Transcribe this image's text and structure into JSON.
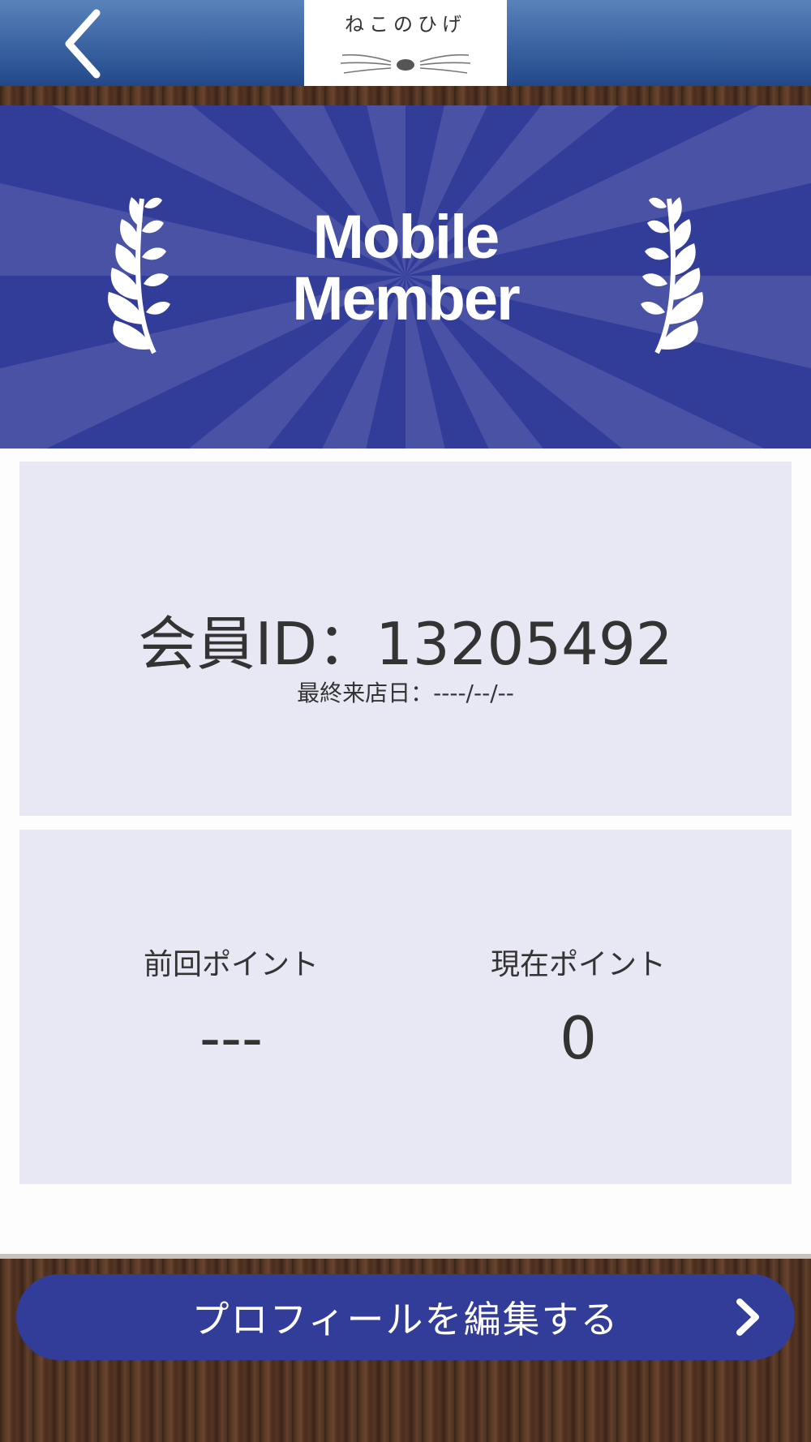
{
  "header": {
    "back_icon": "chevron-left-icon",
    "logo_text": "ねこのひげ"
  },
  "banner": {
    "title_line1": "Mobile",
    "title_line2": "Member",
    "colors": {
      "background": "#323c99",
      "ray": "#4a52a6"
    }
  },
  "member": {
    "id_label": "会員ID：",
    "id_value": "13205492",
    "last_visit": "最終来店日：----/--/--"
  },
  "points": {
    "previous_label": "前回ポイント",
    "previous_value": "---",
    "current_label": "現在ポイント",
    "current_value": "0"
  },
  "footer": {
    "edit_profile_label": "プロフィールを編集する",
    "edit_icon": "chevron-right-icon"
  }
}
